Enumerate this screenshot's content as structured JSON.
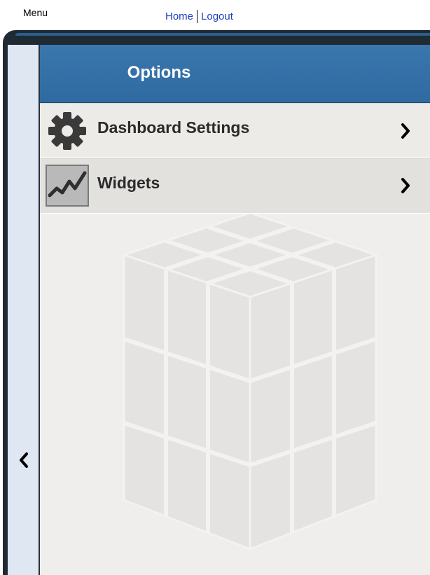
{
  "topbar": {
    "menu_label": "Menu",
    "home_link": "Home",
    "logout_link": "Logout"
  },
  "panel": {
    "title": "Options",
    "items": [
      {
        "label": "Dashboard Settings",
        "icon": "gear-icon"
      },
      {
        "label": "Widgets",
        "icon": "line-chart-icon"
      }
    ]
  },
  "icons": {
    "collapse": "chevron-left-icon",
    "item_arrow": "chevron-right-icon"
  },
  "colors": {
    "header": "#2f6aa1",
    "rail": "#dfe8f2",
    "link": "#1a3fbf",
    "frame": "#1f2a33"
  }
}
